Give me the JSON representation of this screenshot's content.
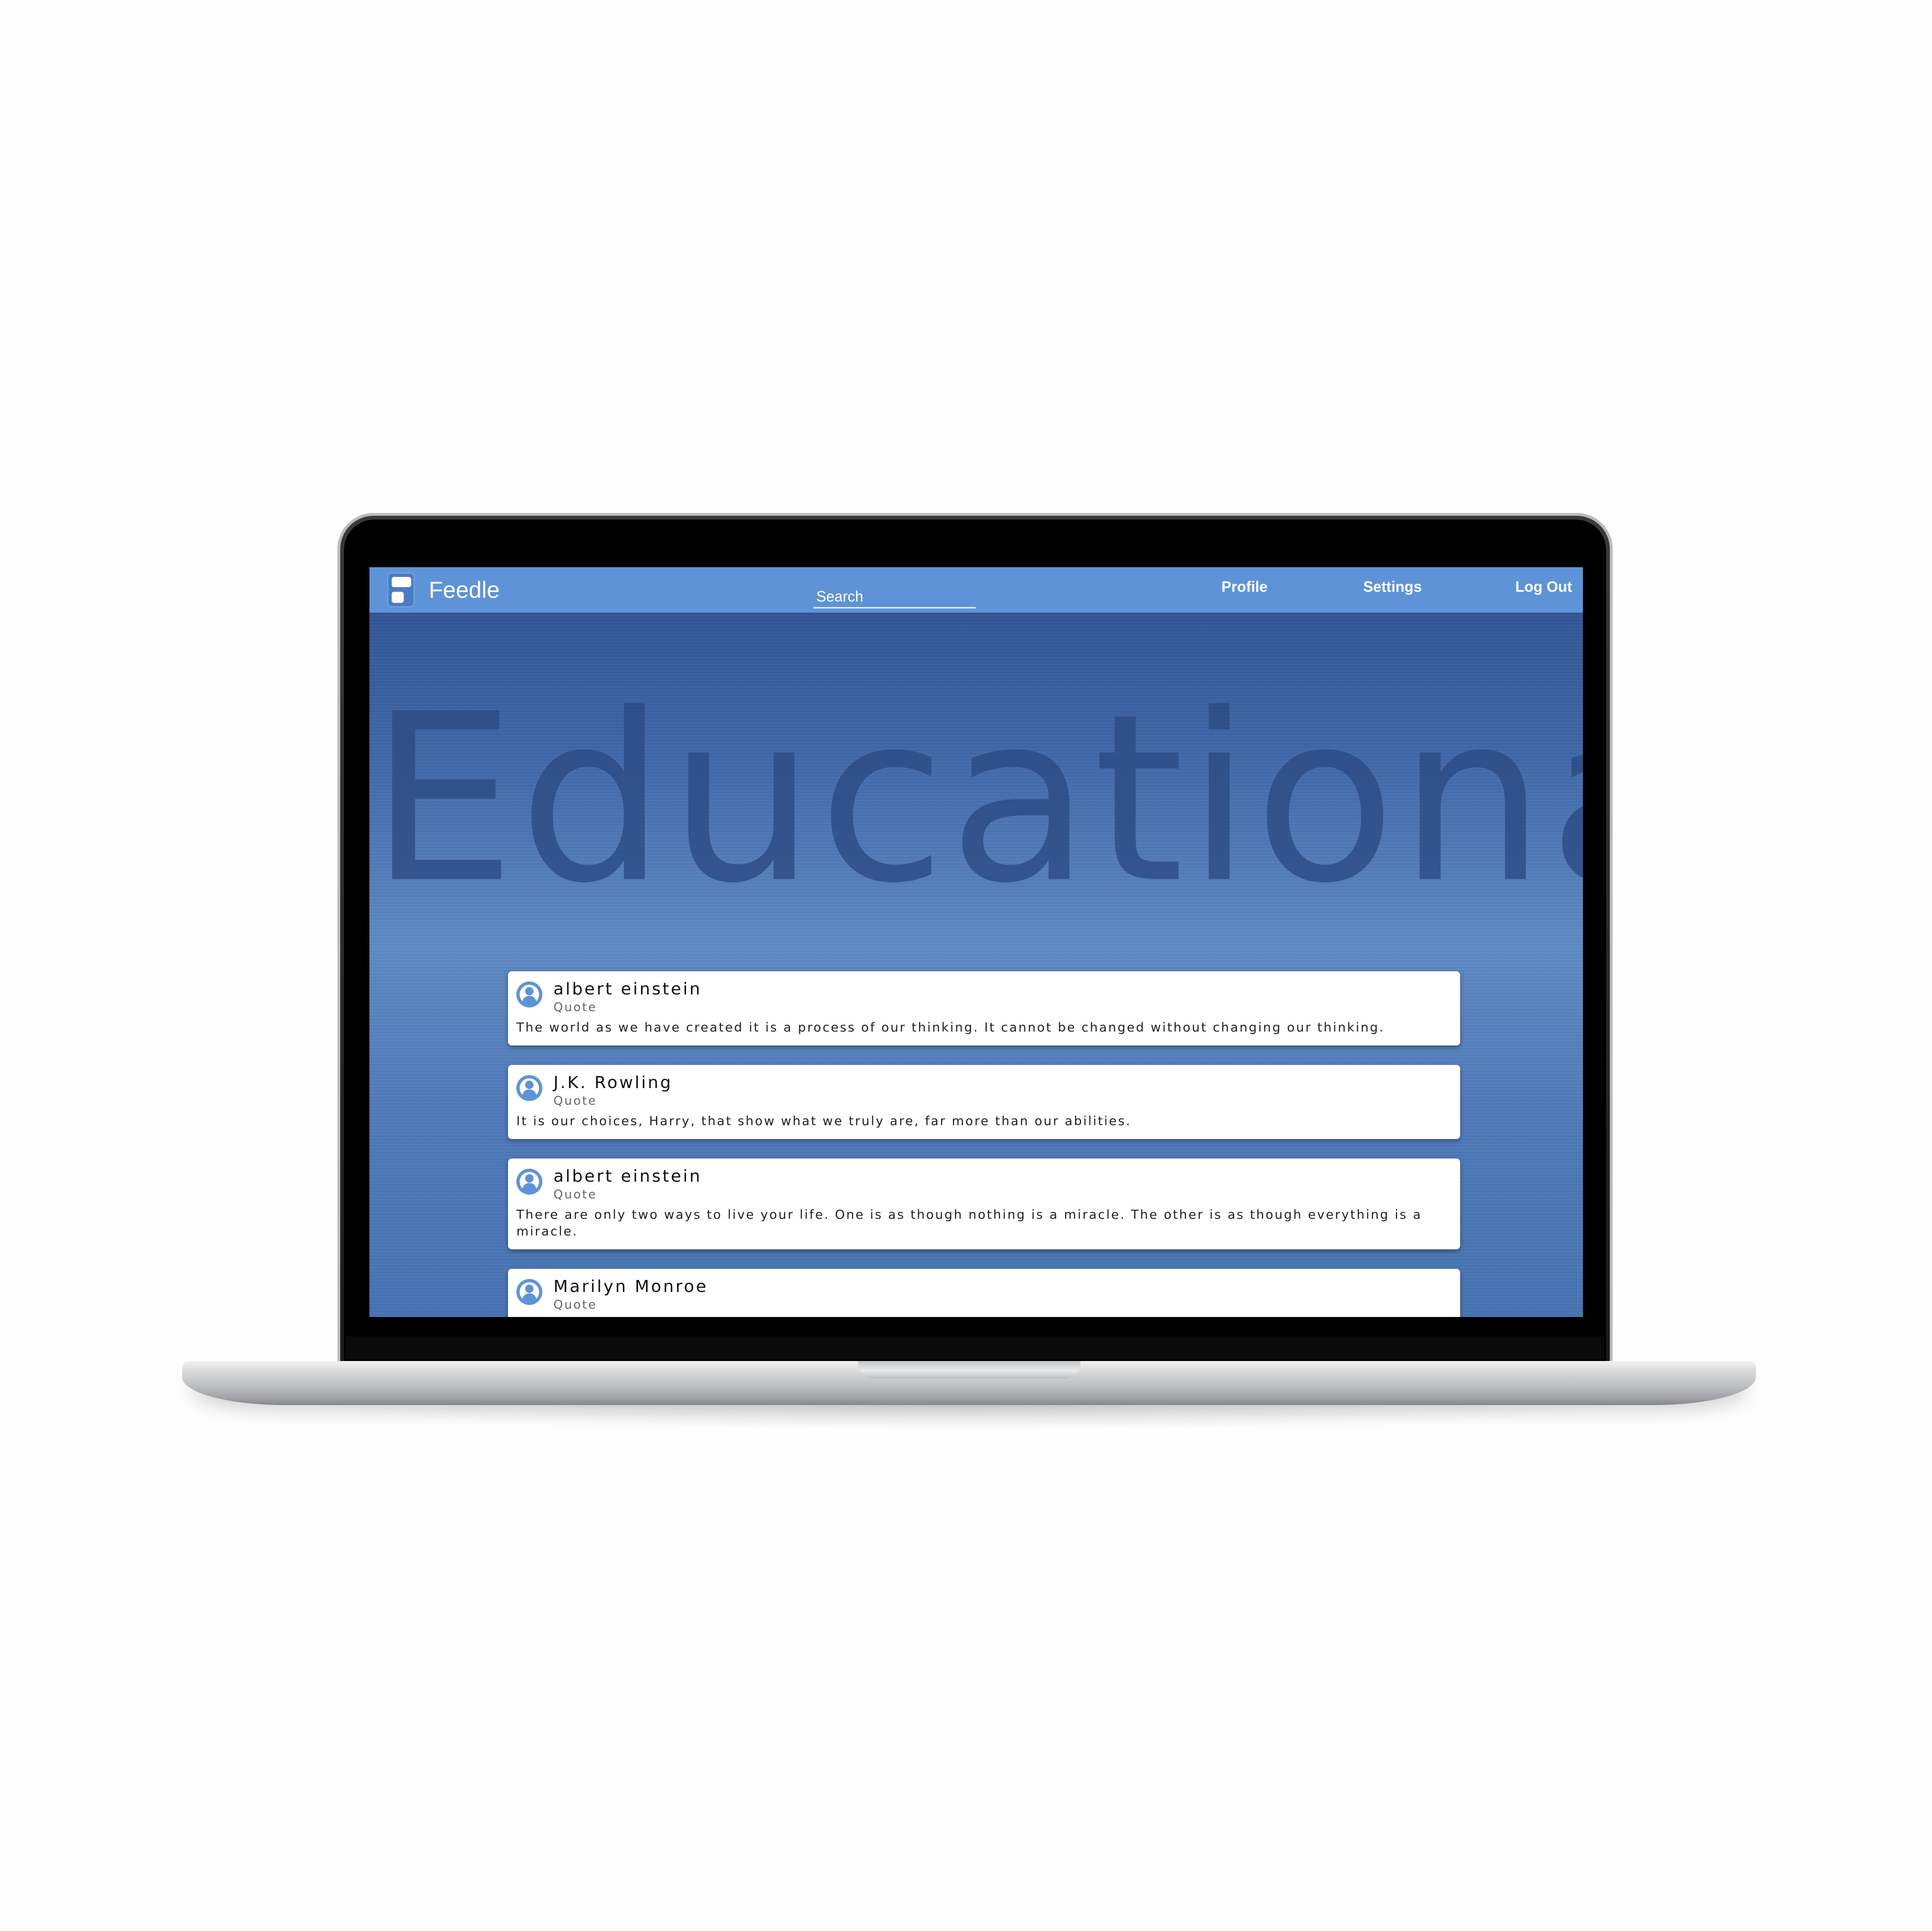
{
  "app": {
    "name": "Feedle",
    "accent_color": "#5f93d7",
    "logo_icon": "feedle-logo-icon"
  },
  "navbar": {
    "search_placeholder": "Search",
    "links": {
      "profile": "Profile",
      "settings": "Settings",
      "logout": "Log Out"
    }
  },
  "category": {
    "title": "Educational"
  },
  "posts": [
    {
      "author": "albert einstein",
      "type": "Quote",
      "text": "The world as we have created it is a process of our thinking. It cannot be changed without changing our thinking."
    },
    {
      "author": "J.K. Rowling",
      "type": "Quote",
      "text": "It is our choices, Harry, that show what we truly are, far more than our abilities."
    },
    {
      "author": "albert einstein",
      "type": "Quote",
      "text": "There are only two ways to live your life. One is as though nothing is a miracle. The other is as though everything is a miracle."
    },
    {
      "author": "Marilyn Monroe",
      "type": "Quote",
      "text": ""
    }
  ]
}
